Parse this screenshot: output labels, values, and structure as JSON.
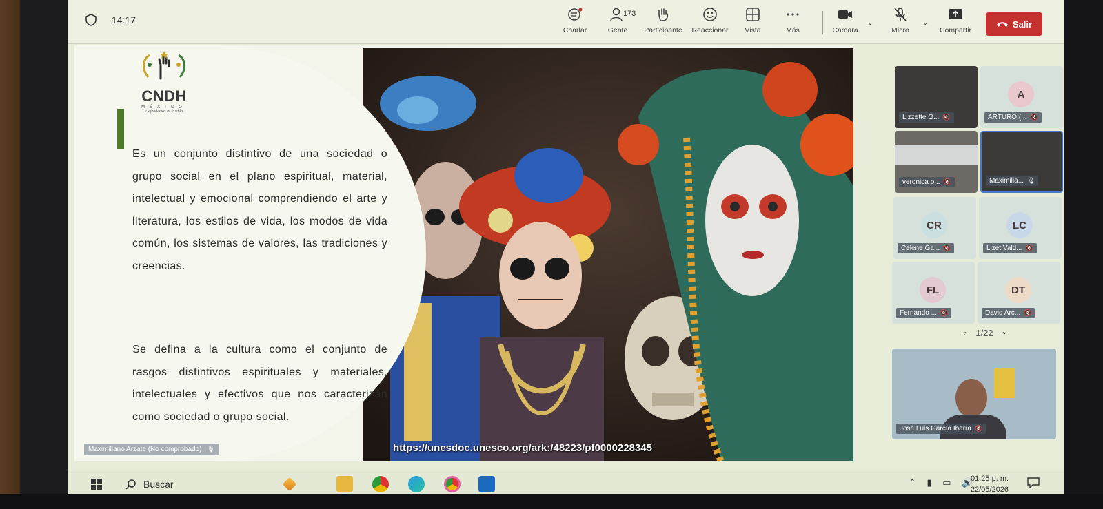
{
  "meeting": {
    "clock": "14:17",
    "participant_count": "173",
    "toolbar": [
      {
        "label": "Charlar",
        "icon": "chat-icon"
      },
      {
        "label": "Gente",
        "icon": "people-icon"
      },
      {
        "label": "Participante",
        "icon": "raise-hand-icon"
      },
      {
        "label": "Reaccionar",
        "icon": "smiley-icon"
      },
      {
        "label": "Vista",
        "icon": "grid-icon"
      },
      {
        "label": "Más",
        "icon": "more-icon"
      },
      {
        "label": "Cámara",
        "icon": "camera-icon"
      },
      {
        "label": "Micro",
        "icon": "mic-off-icon"
      },
      {
        "label": "Compartir",
        "icon": "share-icon"
      }
    ],
    "leave_label": "Salir"
  },
  "slide": {
    "logo": {
      "name": "CNDH",
      "country": "MÉXICO",
      "motto": "Defendemos al Pueblo"
    },
    "paragraph1": "Es un conjunto distintivo de una sociedad o grupo social en el plano espiritual, material, intelectual y emocional comprendiendo el arte y literatura, los estilos de vida, los modos de vida común, los sistemas de valores, las tradiciones y creencias.",
    "paragraph2": "Se defina a la cultura como el conjunto de rasgos distintivos espirituales y materiales, intelectuales y efectivos que nos caracterizan como sociedad o grupo social.",
    "url": "https://unesdoc.unesco.org/ark:/48223/pf0000228345",
    "presenter_tag": "Maximiliano Arzate (No comprobado)"
  },
  "participants": [
    {
      "name": "Lizzette G...",
      "initials": "",
      "style": "dark"
    },
    {
      "name": "ARTURO (...",
      "initials": "A",
      "style": "light",
      "color": "#e8c8cc"
    },
    {
      "name": "veronica p...",
      "initials": "",
      "style": "dark"
    },
    {
      "name": "Maximilia...",
      "initials": "",
      "style": "dark"
    },
    {
      "name": "Celene Ga...",
      "initials": "CR",
      "style": "light",
      "color": "#c9dfe0"
    },
    {
      "name": "Lizet Vald...",
      "initials": "LC",
      "style": "light",
      "color": "#c9d8e8"
    },
    {
      "name": "Fernando ...",
      "initials": "FL",
      "style": "light",
      "color": "#e3c9d2"
    },
    {
      "name": "David Arc...",
      "initials": "DT",
      "style": "light",
      "color": "#ecd9c6"
    }
  ],
  "pager": {
    "prev": "‹",
    "text": "1/22",
    "next": "›"
  },
  "self_view": {
    "name": "José Luis García Ibarra"
  },
  "taskbar": {
    "search_label": "Buscar",
    "time": "01:25 p. m.",
    "date": "22/05/2026"
  },
  "colors": {
    "leave": "#c4312e",
    "accent_green": "#4a7a2a",
    "selected_tile": "#4a78c8"
  }
}
